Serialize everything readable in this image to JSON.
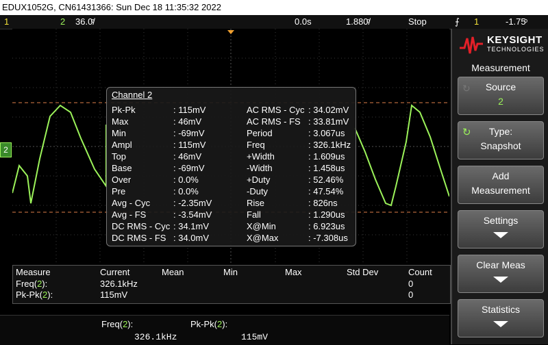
{
  "title_bar": "EDUX1052G, CN61431366: Sun Dec 18 11:35:32 2022",
  "status": {
    "ch1_num": "1",
    "ch2_num": "2",
    "ch2_scale": "36.0ͦ/",
    "time_offset": "0.0s",
    "time_scale": "1.880ͦ/",
    "run_state": "Stop",
    "trigger_icon": "trigger-edge-icon",
    "trigger_source": "1",
    "trigger_level": "-1.75ͦ"
  },
  "channel_marker": "2",
  "popup": {
    "title": "Channel 2",
    "left": [
      {
        "label": "Pk-Pk",
        "value": ": 115mV"
      },
      {
        "label": "Max",
        "value": ": 46mV"
      },
      {
        "label": "Min",
        "value": ": -69mV"
      },
      {
        "label": "Ampl",
        "value": ": 115mV"
      },
      {
        "label": "Top",
        "value": ": 46mV"
      },
      {
        "label": "Base",
        "value": ": -69mV"
      },
      {
        "label": "Over",
        "value": ": 0.0%"
      },
      {
        "label": "Pre",
        "value": ": 0.0%"
      },
      {
        "label": "Avg - Cyc",
        "value": ": -2.35mV"
      },
      {
        "label": "Avg - FS",
        "value": ": -3.54mV"
      },
      {
        "label": "DC RMS - Cyc",
        "value": ": 34.1mV"
      },
      {
        "label": "DC RMS - FS",
        "value": ": 34.0mV"
      }
    ],
    "right": [
      {
        "label": "AC RMS - Cyc",
        "value": ": 34.02mV"
      },
      {
        "label": "AC RMS - FS",
        "value": ": 33.81mV"
      },
      {
        "label": "Period",
        "value": ": 3.067us"
      },
      {
        "label": "Freq",
        "value": ": 326.1kHz"
      },
      {
        "label": "+Width",
        "value": ": 1.609us"
      },
      {
        "label": "-Width",
        "value": ": 1.458us"
      },
      {
        "label": "+Duty",
        "value": ": 52.46%"
      },
      {
        "label": "-Duty",
        "value": ": 47.54%"
      },
      {
        "label": "Rise",
        "value": ": 826ns"
      },
      {
        "label": "Fall",
        "value": ": 1.290us"
      },
      {
        "label": "X@Min",
        "value": ": 6.923us"
      },
      {
        "label": "X@Max",
        "value": ": -7.308us"
      }
    ]
  },
  "table": {
    "headers": [
      "Measure",
      "Current",
      "Mean",
      "Min",
      "Max",
      "Std Dev",
      "Count"
    ],
    "rows": [
      {
        "measure": "Freq(",
        "ch": "2",
        "suffix": "):",
        "current": "326.1kHz",
        "count": "0"
      },
      {
        "measure": "Pk-Pk(",
        "ch": "2",
        "suffix": "):",
        "current": "115mV",
        "count": "0"
      }
    ]
  },
  "footer": {
    "f1_label": "Freq(",
    "f1_ch": "2",
    "f1_suffix": "):",
    "f1_value": "326.1kHz",
    "f2_label": "Pk-Pk(",
    "f2_ch": "2",
    "f2_suffix": "):",
    "f2_value": "115mV"
  },
  "side": {
    "brand": "KEYSIGHT",
    "brand_sub": "TECHNOLOGIES",
    "menu_title": "Measurement",
    "source_label": "Source",
    "source_value": "2",
    "type_label": "Type:",
    "type_value": "Snapshot",
    "add_l1": "Add",
    "add_l2": "Measurement",
    "settings": "Settings",
    "clear": "Clear Meas",
    "statistics": "Statistics"
  },
  "colors": {
    "channel1": "#f5e339",
    "channel2": "#9cf35a",
    "cursor": "#e0804a"
  }
}
